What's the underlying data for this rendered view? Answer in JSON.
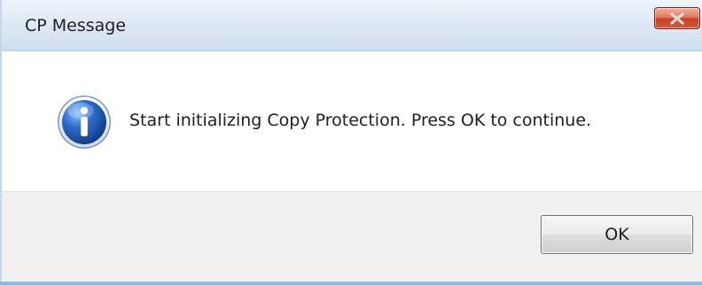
{
  "window": {
    "title": "CP Message",
    "close_icon": "close-icon",
    "info_icon": "info-icon"
  },
  "message": {
    "text": "Start initializing Copy Protection. Press OK to continue."
  },
  "buttons": {
    "ok_label": "OK"
  },
  "colors": {
    "title_bar": "#dfe9f5",
    "close_button": "#c74128",
    "info_blue": "#1f58b6",
    "footer_bg": "#f0f0f0",
    "accent_edge": "#7eb0d6"
  }
}
